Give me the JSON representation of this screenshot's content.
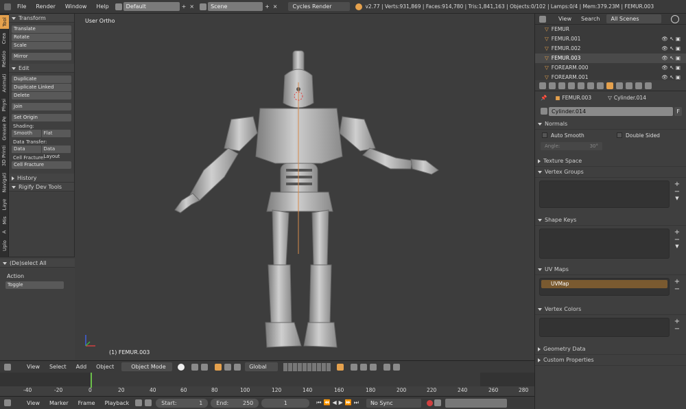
{
  "topbar": {
    "menus": [
      "File",
      "Render",
      "Window",
      "Help"
    ],
    "layout": "Default",
    "scene": "Scene",
    "engine": "Cycles Render",
    "stats": "v2.77 | Verts:931,869 | Faces:914,780 | Tris:1,841,163 | Objects:0/102 | Lamps:0/4 | Mem:379.23M | FEMUR.003"
  },
  "vtabs": [
    "Tool",
    "Crea",
    "Relatio",
    "Animati",
    "Physi",
    "Grease Pe",
    "3D Printi",
    "Navigati",
    "Laye",
    "Mis",
    "A",
    "Uplo"
  ],
  "tools": {
    "transform": {
      "title": "Transform",
      "buttons": [
        "Translate",
        "Rotate",
        "Scale",
        "Mirror"
      ]
    },
    "edit": {
      "title": "Edit",
      "buttons": [
        "Duplicate",
        "Duplicate Linked",
        "Delete",
        "Join",
        "Set Origin"
      ],
      "shading_label": "Shading:",
      "smooth": "Smooth",
      "flat": "Flat",
      "data_transfer_label": "Data Transfer:",
      "data": "Data",
      "data_layout": "Data Layout",
      "cell_fracture_label": "Cell Fracture:",
      "cell_fracture": "Cell Fracture"
    },
    "history": "History",
    "rigify": "Rigify Dev Tools"
  },
  "operator": {
    "title": "(De)select All",
    "action_label": "Action",
    "action_value": "Toggle"
  },
  "viewport": {
    "view_name": "User Ortho",
    "object_label": "(1) FEMUR.003"
  },
  "outliner": {
    "view": "View",
    "search": "Search",
    "filter": "All Scenes",
    "items": [
      "FEMUR",
      "FEMUR.001",
      "FEMUR.002",
      "FEMUR.003",
      "FOREARM.000",
      "FOREARM.001"
    ]
  },
  "props": {
    "breadcrumb_object": "FEMUR.003",
    "breadcrumb_mesh": "Cylinder.014",
    "mesh_name": "Cylinder.014",
    "fake_user": "F",
    "normals": "Normals",
    "auto_smooth": "Auto Smooth",
    "double_sided": "Double Sided",
    "angle_label": "Angle:",
    "angle_value": "30°",
    "texture_space": "Texture Space",
    "vertex_groups": "Vertex Groups",
    "shape_keys": "Shape Keys",
    "uv_maps": "UV Maps",
    "uv_map_item": "UVMap",
    "vertex_colors": "Vertex Colors",
    "geometry_data": "Geometry Data",
    "custom_properties": "Custom Properties"
  },
  "header3d": {
    "menus": [
      "View",
      "Select",
      "Add",
      "Object"
    ],
    "mode": "Object Mode",
    "orientation": "Global"
  },
  "timeline": {
    "ticks": [
      "-40",
      "-20",
      "0",
      "20",
      "40",
      "60",
      "80",
      "100",
      "120",
      "140",
      "160",
      "180",
      "200",
      "220",
      "240",
      "260",
      "280"
    ]
  },
  "tlheader": {
    "menus": [
      "View",
      "Marker",
      "Frame",
      "Playback"
    ],
    "start_label": "Start:",
    "start_value": "1",
    "end_label": "End:",
    "end_value": "250",
    "current": "1",
    "sync": "No Sync"
  },
  "colors": {
    "accent": "#e5a14d",
    "selected_row": "#9a6a33",
    "uvmap_row": "#7a5a30",
    "frame_marker": "#6cc04a"
  }
}
